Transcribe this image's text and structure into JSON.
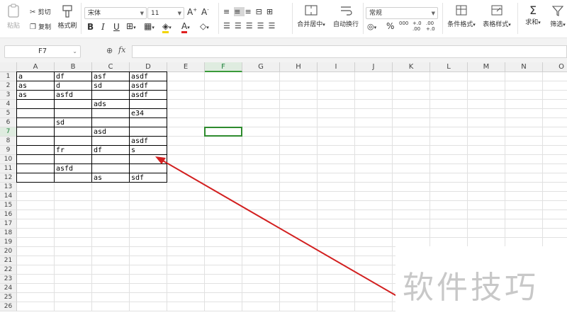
{
  "toolbar": {
    "paste": "粘贴",
    "cut": "剪切",
    "copy": "复制",
    "format_painter": "格式刷",
    "font_name": "宋体",
    "font_size": "11",
    "merge_center": "合并居中",
    "wrap_text": "自动换行",
    "number_format": "常规",
    "conditional_format": "条件格式",
    "table_style": "表格样式",
    "sum": "求和",
    "filter": "筛选",
    "percent": "%",
    "thousands": "000",
    "inc_decimal": "+.0 .00",
    "dec_decimal": ".00 +.0"
  },
  "formula_bar": {
    "cell_ref": "F7",
    "fx": "fx",
    "content": ""
  },
  "grid": {
    "columns": [
      "A",
      "B",
      "C",
      "D",
      "E",
      "F",
      "G",
      "H",
      "I",
      "J",
      "K",
      "L",
      "M",
      "N",
      "O"
    ],
    "rows": [
      "1",
      "2",
      "3",
      "4",
      "5",
      "6",
      "7",
      "8",
      "9",
      "10",
      "11",
      "12",
      "13",
      "14",
      "15",
      "16",
      "17",
      "18",
      "19",
      "20",
      "21",
      "22",
      "23",
      "24",
      "25",
      "26"
    ],
    "selected_col": "F",
    "selected_row": "7",
    "cells": [
      {
        "ref": "A1",
        "text": "a"
      },
      {
        "ref": "B1",
        "text": "df"
      },
      {
        "ref": "C1",
        "text": "asf"
      },
      {
        "ref": "D1",
        "text": "asdf"
      },
      {
        "ref": "A2",
        "text": "as"
      },
      {
        "ref": "B2",
        "text": "d"
      },
      {
        "ref": "C2",
        "text": "sd"
      },
      {
        "ref": "D2",
        "text": "asdf"
      },
      {
        "ref": "A3",
        "text": "as"
      },
      {
        "ref": "B3",
        "text": "asfd"
      },
      {
        "ref": "D3",
        "text": "asdf"
      },
      {
        "ref": "C4",
        "text": "ads"
      },
      {
        "ref": "D5",
        "text": "e34"
      },
      {
        "ref": "B6",
        "text": "sd"
      },
      {
        "ref": "C7",
        "text": "asd"
      },
      {
        "ref": "D8",
        "text": "asdf"
      },
      {
        "ref": "B9",
        "text": "fr"
      },
      {
        "ref": "C9",
        "text": "df"
      },
      {
        "ref": "D9",
        "text": "s"
      },
      {
        "ref": "B11",
        "text": "asfd"
      },
      {
        "ref": "C12",
        "text": "as"
      },
      {
        "ref": "D12",
        "text": "sdf"
      }
    ]
  },
  "annotation": {
    "color": "#d21f1f"
  },
  "watermark": "软件技巧"
}
